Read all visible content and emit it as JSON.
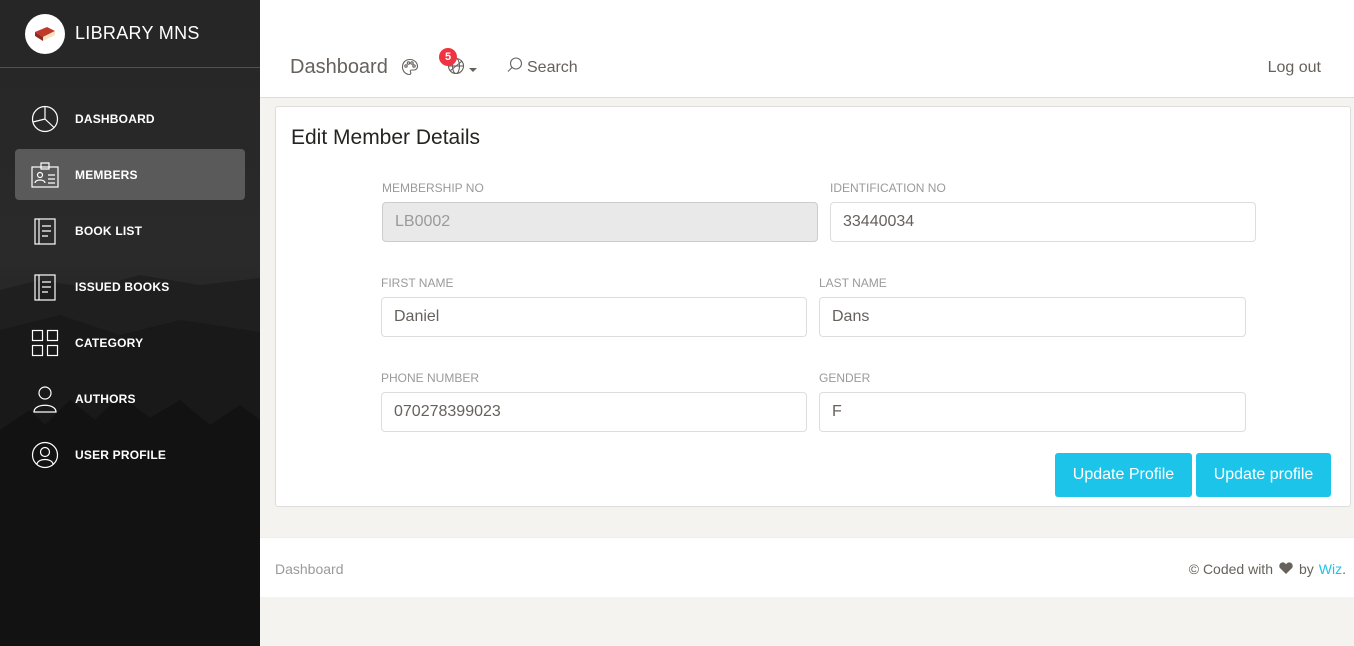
{
  "sidebar": {
    "brand": "LIBRARY MNS",
    "items": [
      {
        "label": "Dashboard",
        "icon": "pie-chart-icon"
      },
      {
        "label": "Members",
        "icon": "id-card-icon"
      },
      {
        "label": "Book List",
        "icon": "document-list-icon"
      },
      {
        "label": "Issued Books",
        "icon": "document-list-icon"
      },
      {
        "label": "Category",
        "icon": "grid-icon"
      },
      {
        "label": "Authors",
        "icon": "person-icon"
      },
      {
        "label": "User Profile",
        "icon": "user-circle-icon"
      }
    ],
    "active_item": "Members"
  },
  "topbar": {
    "title": "Dashboard",
    "notification_count": "5",
    "search_label": "Search",
    "logout_label": "Log out"
  },
  "form": {
    "title": "Edit Member Details",
    "membership_no": {
      "label": "Membership No",
      "value": "LB0002"
    },
    "identification_no": {
      "label": "Identification No",
      "value": "33440034"
    },
    "first_name": {
      "label": "First Name",
      "value": "Daniel"
    },
    "last_name": {
      "label": "Last Name",
      "value": "Dans"
    },
    "phone_number": {
      "label": "Phone Number",
      "value": "070278399023"
    },
    "gender": {
      "label": "Gender",
      "value": "F"
    },
    "buttons": {
      "update_profile_1": "Update Profile",
      "update_profile_2": "Update profile"
    }
  },
  "footer": {
    "left_link": "Dashboard",
    "credit_prefix": "© Coded with",
    "credit_by": "by",
    "credit_author": "Wiz",
    "credit_suffix": "."
  },
  "colors": {
    "accent": "#1dc4e9",
    "badge": "#ef3340",
    "sidebar_bg": "#262626"
  }
}
